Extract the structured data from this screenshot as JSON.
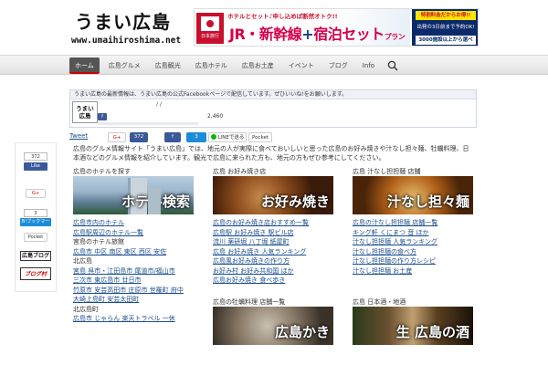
{
  "header": {
    "site_title": "うまい広島",
    "site_url": "www.umaihiroshima.net"
  },
  "banner": {
    "brand": "日本旅行",
    "top_text": "ホテルとセット♪申し込めば断然オトク!!",
    "main_text_1": "JR・新幹線",
    "main_text_2": "+",
    "main_text_3": "宿泊セット",
    "main_text_4": "プラン",
    "right_1": "特割料金だからお得!!",
    "right_2": "出発の3日前まで予約OK!",
    "right_3": "3000施設以上から選べる!"
  },
  "nav": {
    "items": [
      {
        "label": "ホーム"
      },
      {
        "label": "広島グルメ"
      },
      {
        "label": "広島観光"
      },
      {
        "label": "広島ホテル"
      },
      {
        "label": "広島お土産"
      },
      {
        "label": "イベント"
      },
      {
        "label": "ブログ"
      },
      {
        "label": "Info"
      }
    ]
  },
  "facebook_box": {
    "heading": "うまい広島の最新情報は、うまい広島の公式Facebookページで配信しています。ぜひいいね!をお願いします。",
    "thumb_line1": "うまい",
    "thumb_line2": "広島",
    "slashes": "/    /",
    "like_label": "f",
    "count": "2,460"
  },
  "share_row": {
    "tweet": "Tweet",
    "gplus": "G+",
    "like": "372",
    "fb": "f",
    "hatena": "3",
    "line": "LINEで送る",
    "pocket": "Pocket"
  },
  "sidebar": {
    "fb_count": "372",
    "fb_like": "Like",
    "gplus": "G+",
    "hatena_count": "3",
    "hatena": "B!ブックマーク",
    "pocket": "Pocket",
    "blog": "広島ブログ",
    "mura": "ブログ村"
  },
  "intro": "広島のグルメ情報サイト「うまい広島」では、地元の人が実際に食べておいしいと思った広島のお好み焼きや汁なし担々麺、牡蠣料理、日本酒などのグルメ情報を紹介しています。観光で広島に来られた方も、地元の方もぜひ参考にしてください。",
  "cards": [
    {
      "title": "広島のホテルを探す",
      "image_label": "ホテル検索",
      "links": [
        {
          "text": "広島市内のホテル",
          "link": true
        },
        {
          "text": "広島駅周辺のホテル一覧",
          "link": true
        },
        {
          "text": "宮島のホテル旅館",
          "link": false
        },
        {
          "text": "広島市 中区 南区 東区 西区 安佐",
          "link": true
        },
        {
          "text": "北広島",
          "link": false
        },
        {
          "text": "宮島 呉市・江田島市 尾道市/福山市",
          "link": true
        },
        {
          "text": "三次市 東広島市 廿日市",
          "link": true
        },
        {
          "text": "竹原市 安芸高田市 庄原市 世羅町 府中",
          "link": true
        },
        {
          "text": "大崎上島町 安芸太田町",
          "link": true
        },
        {
          "text": "北広島町",
          "link": false
        },
        {
          "text": "広島市 じゃらん 楽天トラベル 一休",
          "link": true
        }
      ]
    },
    {
      "title": "広島 お好み焼き店",
      "image_label": "お好み焼き",
      "links": [
        {
          "text": "広島のお好み焼き店おすすめ一覧",
          "link": true
        },
        {
          "text": "広島駅 お好み焼き 駅ビル店",
          "link": true
        },
        {
          "text": "流川 薬研堀 八丁堀 紙屋町",
          "link": true
        },
        {
          "text": "広島 お好み焼き 人気ランキング",
          "link": true
        },
        {
          "text": "広島風お好み焼きの作り方",
          "link": true
        },
        {
          "text": "お好み村 お好み共和国 ほか",
          "link": true
        },
        {
          "text": "広島お好み焼き 食べ歩き",
          "link": true
        }
      ]
    },
    {
      "title": "広島 汁なし担担麺 店舗",
      "image_label": "汁なし担々麺",
      "links": [
        {
          "text": "広島の汁なし担担麺 店舗一覧",
          "link": true
        },
        {
          "text": "キング軒 くにまつ 音 ほか",
          "link": true
        },
        {
          "text": "汁なし担担麺 人気ランキング",
          "link": true
        },
        {
          "text": "汁なし担担麺の食べ方",
          "link": true
        },
        {
          "text": "汁なし担担麺の作り方レシピ",
          "link": true
        },
        {
          "text": "汁なし担担麺 お土産",
          "link": true
        }
      ]
    },
    {
      "title": "広島の牡蠣料理 店舗一覧",
      "image_label": "広島かき",
      "links": []
    },
    {
      "title": "広島 日本酒・地酒",
      "image_label": "生 広島の酒",
      "links": []
    }
  ],
  "colors": {
    "link": "#1a4d8f",
    "nav_active": "#555555",
    "accent_red": "#cc0000",
    "facebook": "#3b5998",
    "hatena": "#1d8cd6"
  }
}
